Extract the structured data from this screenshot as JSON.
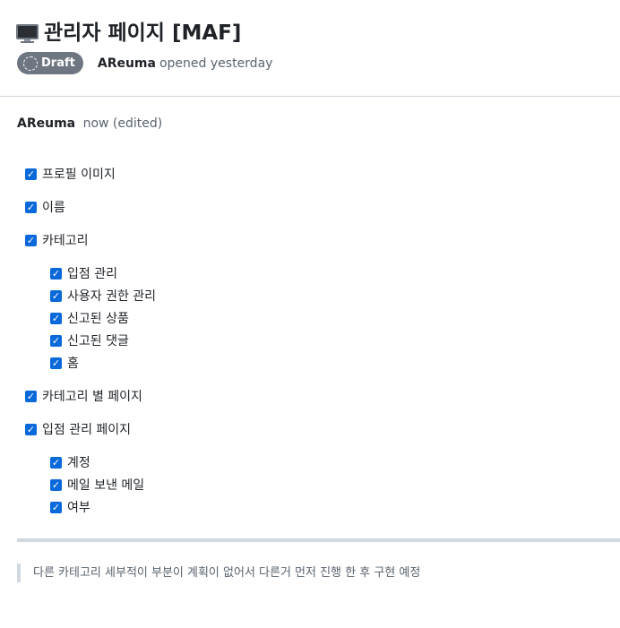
{
  "header": {
    "title": "관리자 페이지 [MAF]",
    "title_icon": "desktop-computer-icon",
    "status_badge": "Draft",
    "author": "AReuma",
    "opened_text": "opened yesterday"
  },
  "comment": {
    "author": "AReuma",
    "timestamp": "now (edited)",
    "tasks": [
      {
        "label": "프로필 이미지",
        "checked": true,
        "level": 0
      },
      {
        "label": "이름",
        "checked": true,
        "level": 0
      },
      {
        "label": "카테고리",
        "checked": true,
        "level": 0
      },
      {
        "label": "입점 관리",
        "checked": true,
        "level": 1
      },
      {
        "label": "사용자 권한 관리",
        "checked": true,
        "level": 1
      },
      {
        "label": "신고된 상품",
        "checked": true,
        "level": 1
      },
      {
        "label": "신고된 댓글",
        "checked": true,
        "level": 1
      },
      {
        "label": "홈",
        "checked": true,
        "level": 1
      },
      {
        "label": "카테고리 별 페이지",
        "checked": true,
        "level": 0
      },
      {
        "label": "입점 관리 페이지",
        "checked": true,
        "level": 0
      },
      {
        "label": "계정",
        "checked": true,
        "level": 1
      },
      {
        "label": "메일 보낸 메일",
        "checked": true,
        "level": 1
      },
      {
        "label": "여부",
        "checked": true,
        "level": 1
      }
    ],
    "quote": "다른 카테고리 세부적이 부분이 계획이 없어서 다른거 먼저 진행 한 후 구현 예정"
  },
  "colors": {
    "checkbox": "#0969da",
    "badge": "#6e7781",
    "muted_text": "#59636e",
    "border": "#d1d9e0"
  }
}
